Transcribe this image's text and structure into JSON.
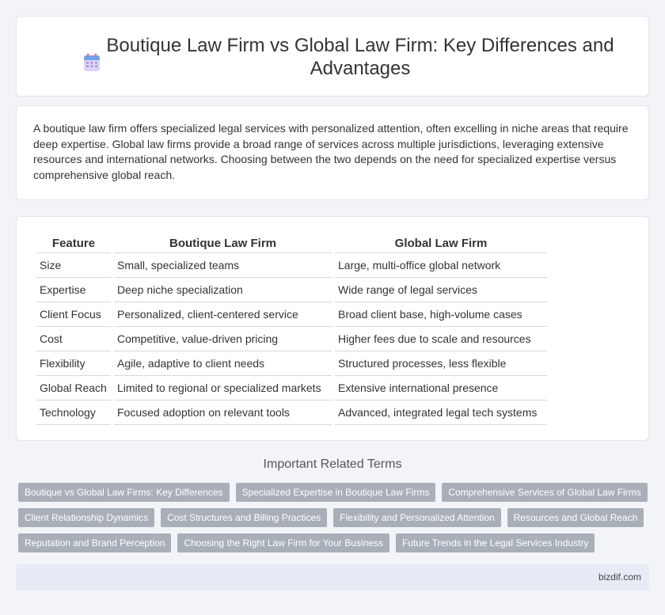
{
  "header": {
    "icon": "calendar-icon",
    "title": "Boutique Law Firm vs Global Law Firm: Key Differences and Advantages"
  },
  "intro": {
    "text": "A boutique law firm offers specialized legal services with personalized attention, often excelling in niche areas that require deep expertise. Global law firms provide a broad range of services across multiple jurisdictions, leveraging extensive resources and international networks. Choosing between the two depends on the need for specialized expertise versus comprehensive global reach."
  },
  "table": {
    "headers": [
      "Feature",
      "Boutique Law Firm",
      "Global Law Firm"
    ],
    "rows": [
      [
        "Size",
        "Small, specialized teams",
        "Large, multi-office global network"
      ],
      [
        "Expertise",
        "Deep niche specialization",
        "Wide range of legal services"
      ],
      [
        "Client Focus",
        "Personalized, client-centered service",
        "Broad client base, high-volume cases"
      ],
      [
        "Cost",
        "Competitive, value-driven pricing",
        "Higher fees due to scale and resources"
      ],
      [
        "Flexibility",
        "Agile, adaptive to client needs",
        "Structured processes, less flexible"
      ],
      [
        "Global Reach",
        "Limited to regional or specialized markets",
        "Extensive international presence"
      ],
      [
        "Technology",
        "Focused adoption on relevant tools",
        "Advanced, integrated legal tech systems"
      ]
    ]
  },
  "related": {
    "title": "Important Related Terms",
    "rows": [
      [
        "Boutique vs Global Law Firms: Key Differences",
        "Specialized Expertise in Boutique Law Firms",
        "Comprehensive Services of Global Law Firms"
      ],
      [
        "Client Relationship Dynamics",
        "Cost Structures and Billing Practices",
        "Flexibility and Personalized Attention",
        "Resources and Global Reach"
      ],
      [
        "Reputation and Brand Perception",
        "Choosing the Right Law Firm for Your Business",
        "Future Trends in the Legal Services Industry"
      ]
    ]
  },
  "footer": {
    "site": "bizdif.com"
  },
  "colors": {
    "tag_bg": "#a9afb9",
    "footer_bg": "#e6ebf5",
    "page_bg": "#f3f4f7"
  }
}
